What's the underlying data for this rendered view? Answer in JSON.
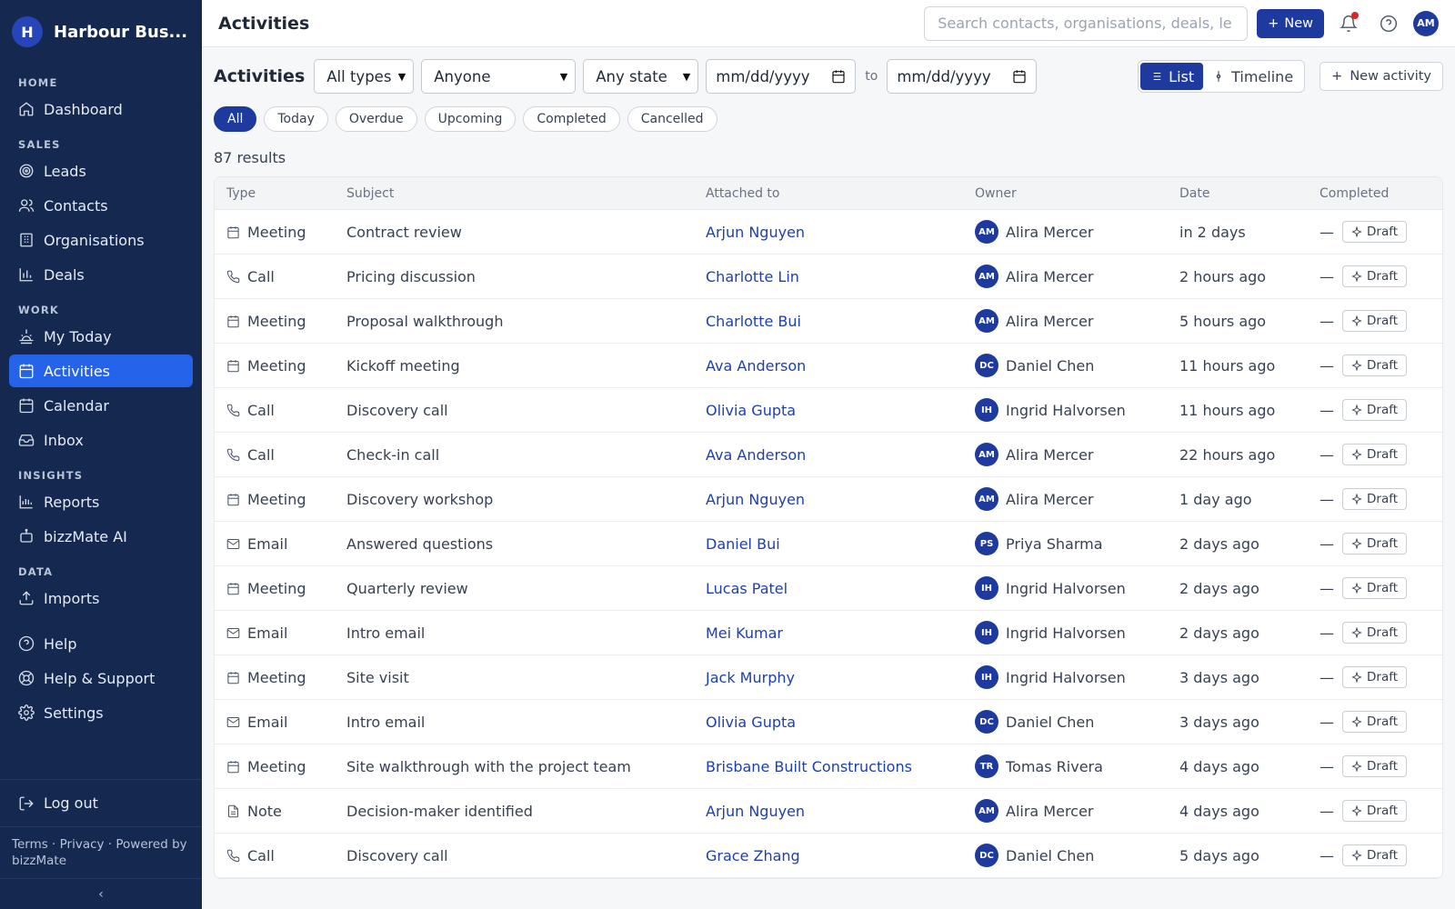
{
  "brand": {
    "logo_letter": "H",
    "name": "Harbour Bus..."
  },
  "sidebar": {
    "sections": [
      {
        "title": "HOME",
        "items": [
          {
            "label": "Dashboard",
            "icon": "home-icon"
          }
        ]
      },
      {
        "title": "SALES",
        "items": [
          {
            "label": "Leads",
            "icon": "target-icon"
          },
          {
            "label": "Contacts",
            "icon": "users-icon"
          },
          {
            "label": "Organisations",
            "icon": "building-icon"
          },
          {
            "label": "Deals",
            "icon": "bar-chart-icon"
          }
        ]
      },
      {
        "title": "WORK",
        "items": [
          {
            "label": "My Today",
            "icon": "sunrise-icon"
          },
          {
            "label": "Activities",
            "icon": "calendar-icon",
            "active": true
          },
          {
            "label": "Calendar",
            "icon": "calendar-icon"
          },
          {
            "label": "Inbox",
            "icon": "inbox-icon"
          }
        ]
      },
      {
        "title": "INSIGHTS",
        "items": [
          {
            "label": "Reports",
            "icon": "reports-icon"
          },
          {
            "label": "bizzMate AI",
            "icon": "bot-icon"
          }
        ]
      },
      {
        "title": "DATA",
        "items": [
          {
            "label": "Imports",
            "icon": "upload-icon"
          }
        ]
      }
    ],
    "extra_items": [
      {
        "label": "Help",
        "icon": "help-icon"
      },
      {
        "label": "Help & Support",
        "icon": "lifebuoy-icon"
      },
      {
        "label": "Settings",
        "icon": "gear-icon"
      }
    ],
    "logout_label": "Log out",
    "footer": "Terms · Privacy · Powered by bizzMate",
    "collapse_label": "‹"
  },
  "topbar": {
    "title": "Activities",
    "search_placeholder": "Search contacts, organisations, deals, le",
    "new_label": "New",
    "avatar": "AM"
  },
  "filters": {
    "title": "Activities",
    "type": "All types",
    "owner": "Anyone",
    "state": "Any state",
    "date_from": "mm/dd/yyyy",
    "to_label": "to",
    "date_to": "mm/dd/yyyy",
    "view_list": "List",
    "view_timeline": "Timeline",
    "new_activity": "New activity"
  },
  "pills": [
    {
      "label": "All",
      "active": true
    },
    {
      "label": "Today"
    },
    {
      "label": "Overdue"
    },
    {
      "label": "Upcoming"
    },
    {
      "label": "Completed"
    },
    {
      "label": "Cancelled"
    }
  ],
  "results_text": "87 results",
  "table": {
    "columns": [
      "Type",
      "Subject",
      "Attached to",
      "Owner",
      "Date",
      "Completed"
    ],
    "completed_dash": "—",
    "draft_label": "Draft",
    "rows": [
      {
        "type": "Meeting",
        "subject": "Contract review",
        "attached": "Arjun Nguyen",
        "owner_initials": "AM",
        "owner": "Alira Mercer",
        "date": "in 2 days"
      },
      {
        "type": "Call",
        "subject": "Pricing discussion",
        "attached": "Charlotte Lin",
        "owner_initials": "AM",
        "owner": "Alira Mercer",
        "date": "2 hours ago"
      },
      {
        "type": "Meeting",
        "subject": "Proposal walkthrough",
        "attached": "Charlotte Bui",
        "owner_initials": "AM",
        "owner": "Alira Mercer",
        "date": "5 hours ago"
      },
      {
        "type": "Meeting",
        "subject": "Kickoff meeting",
        "attached": "Ava Anderson",
        "owner_initials": "DC",
        "owner": "Daniel Chen",
        "date": "11 hours ago"
      },
      {
        "type": "Call",
        "subject": "Discovery call",
        "attached": "Olivia Gupta",
        "owner_initials": "IH",
        "owner": "Ingrid Halvorsen",
        "date": "11 hours ago"
      },
      {
        "type": "Call",
        "subject": "Check-in call",
        "attached": "Ava Anderson",
        "owner_initials": "AM",
        "owner": "Alira Mercer",
        "date": "22 hours ago"
      },
      {
        "type": "Meeting",
        "subject": "Discovery workshop",
        "attached": "Arjun Nguyen",
        "owner_initials": "AM",
        "owner": "Alira Mercer",
        "date": "1 day ago"
      },
      {
        "type": "Email",
        "subject": "Answered questions",
        "attached": "Daniel Bui",
        "owner_initials": "PS",
        "owner": "Priya Sharma",
        "date": "2 days ago"
      },
      {
        "type": "Meeting",
        "subject": "Quarterly review",
        "attached": "Lucas Patel",
        "owner_initials": "IH",
        "owner": "Ingrid Halvorsen",
        "date": "2 days ago"
      },
      {
        "type": "Email",
        "subject": "Intro email",
        "attached": "Mei Kumar",
        "owner_initials": "IH",
        "owner": "Ingrid Halvorsen",
        "date": "2 days ago"
      },
      {
        "type": "Meeting",
        "subject": "Site visit",
        "attached": "Jack Murphy",
        "owner_initials": "IH",
        "owner": "Ingrid Halvorsen",
        "date": "3 days ago"
      },
      {
        "type": "Email",
        "subject": "Intro email",
        "attached": "Olivia Gupta",
        "owner_initials": "DC",
        "owner": "Daniel Chen",
        "date": "3 days ago"
      },
      {
        "type": "Meeting",
        "subject": "Site walkthrough with the project team",
        "attached": "Brisbane Built Constructions",
        "owner_initials": "TR",
        "owner": "Tomas Rivera",
        "date": "4 days ago"
      },
      {
        "type": "Note",
        "subject": "Decision-maker identified",
        "attached": "Arjun Nguyen",
        "owner_initials": "AM",
        "owner": "Alira Mercer",
        "date": "4 days ago"
      },
      {
        "type": "Call",
        "subject": "Discovery call",
        "attached": "Grace Zhang",
        "owner_initials": "DC",
        "owner": "Daniel Chen",
        "date": "5 days ago"
      }
    ]
  },
  "colors": {
    "sidebar_bg": "#142850",
    "accent": "#1e3a9f",
    "active_nav": "#2563eb",
    "link": "#1e40af",
    "notification": "#dc2626"
  }
}
